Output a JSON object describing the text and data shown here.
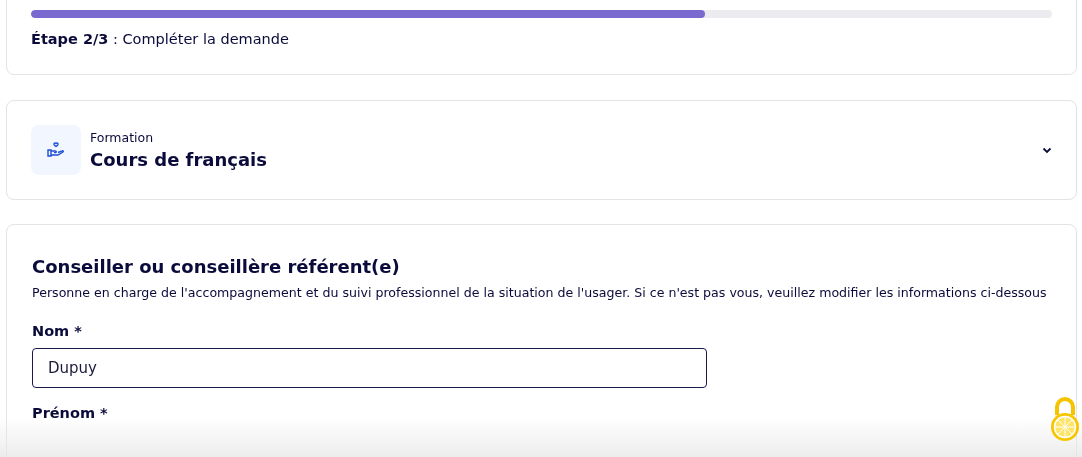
{
  "progress": {
    "level": 0.66,
    "step": "Étape 2/3",
    "label": " : Compléter la demande"
  },
  "service": {
    "category": "Formation",
    "title": "Cours de français",
    "expanded": false
  },
  "referent": {
    "title": "Conseiller ou conseillère référent(e)",
    "description": "Personne en charge de l'accompagnement et du suivi professionnel de la situation de l'usager. Si ce n'est pas vous, veuillez modifier les informations ci-dessous",
    "fields": [
      {
        "label": "Nom *",
        "value": "Dupuy"
      },
      {
        "label": "Prénom *"
      }
    ]
  }
}
